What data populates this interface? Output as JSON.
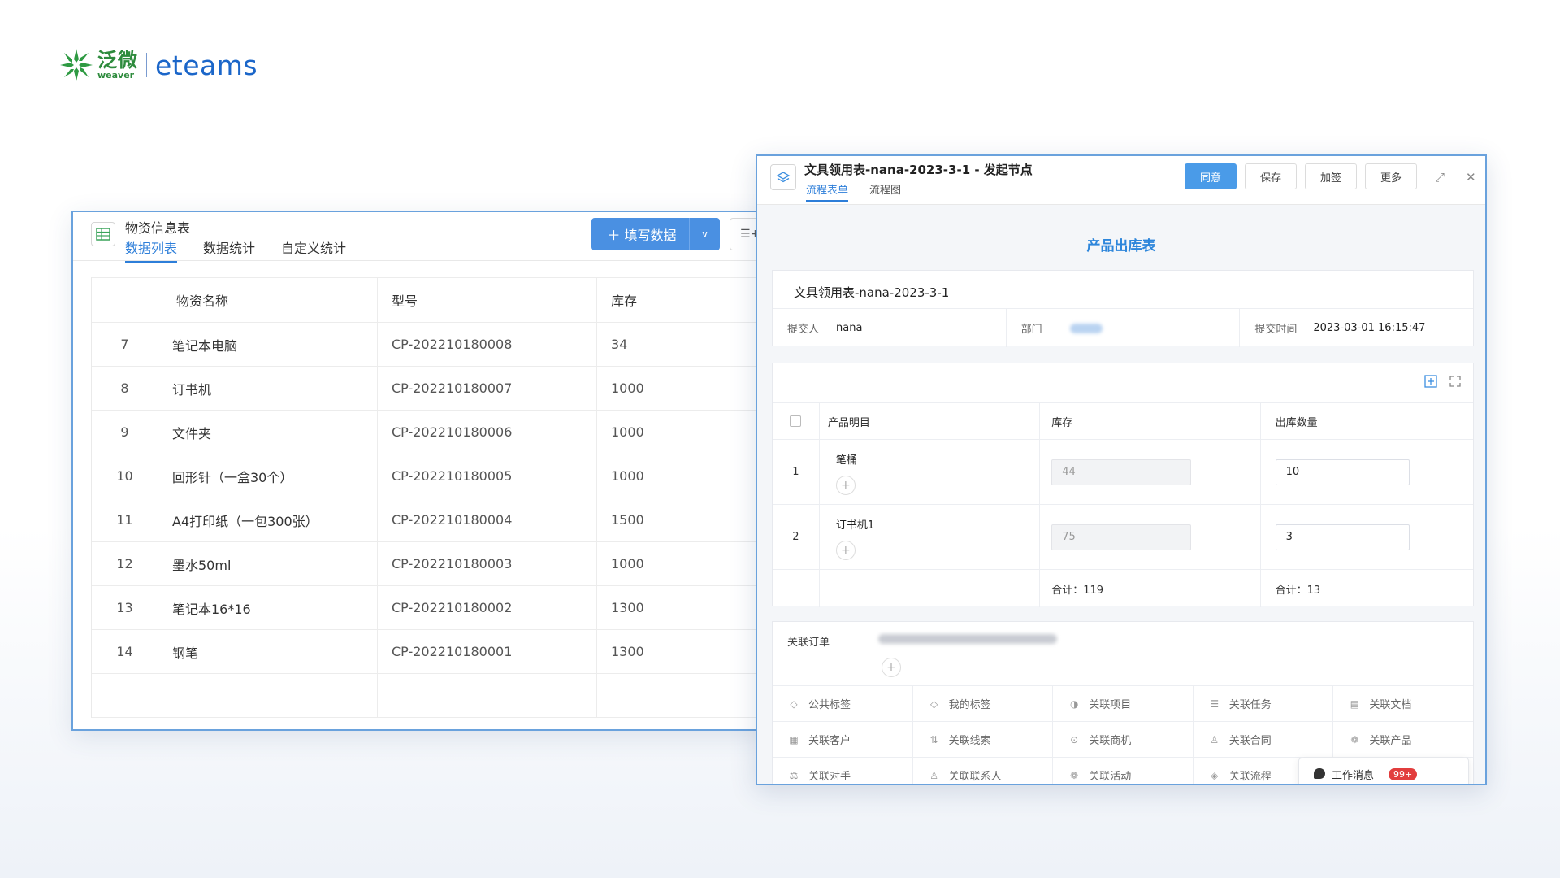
{
  "logo": {
    "zh": "泛微",
    "en": "weaver",
    "brand": "eteams"
  },
  "list_window": {
    "title": "物资信息表",
    "tabs": [
      "数据列表",
      "数据统计",
      "自定义统计"
    ],
    "fill_button": "＋ 填写数据",
    "columns": [
      "",
      "物资名称",
      "型号",
      "库存"
    ],
    "rows": [
      {
        "no": "7",
        "name": "笔记本电脑",
        "model": "CP-202210180008",
        "stock": "34"
      },
      {
        "no": "8",
        "name": "订书机",
        "model": "CP-202210180007",
        "stock": "1000"
      },
      {
        "no": "9",
        "name": "文件夹",
        "model": "CP-202210180006",
        "stock": "1000"
      },
      {
        "no": "10",
        "name": "回形针（一盒30个）",
        "model": "CP-202210180005",
        "stock": "1000"
      },
      {
        "no": "11",
        "name": "A4打印纸（一包300张）",
        "model": "CP-202210180004",
        "stock": "1500"
      },
      {
        "no": "12",
        "name": "墨水50ml",
        "model": "CP-202210180003",
        "stock": "1000"
      },
      {
        "no": "13",
        "name": "笔记本16*16",
        "model": "CP-202210180002",
        "stock": "1300"
      },
      {
        "no": "14",
        "name": "钢笔",
        "model": "CP-202210180001",
        "stock": "1300"
      }
    ]
  },
  "form_window": {
    "title": "文具领用表-nana-2023-3-1 - 发起节点",
    "tabs": [
      "流程表单",
      "流程图"
    ],
    "actions": [
      "同意",
      "保存",
      "加签",
      "更多"
    ],
    "form_title": "产品出库表",
    "record_name": "文具领用表-nana-2023-3-1",
    "submitter_label": "提交人",
    "submitter": "nana",
    "dept_label": "部门",
    "time_label": "提交时间",
    "time": "2023-03-01 16:15:47",
    "table_headers": [
      "产品明目",
      "库存",
      "出库数量"
    ],
    "rows": [
      {
        "no": "1",
        "product": "笔桶",
        "stock": "44",
        "qty": "10"
      },
      {
        "no": "2",
        "product": "订书机1",
        "stock": "75",
        "qty": "3"
      }
    ],
    "sum_stock": "合计：119",
    "sum_qty": "合计：13",
    "related_order_label": "关联订单",
    "related_items": [
      [
        "公共标签",
        "我的标签",
        "关联项目",
        "关联任务",
        "关联文档"
      ],
      [
        "关联客户",
        "关联线索",
        "关联商机",
        "关联合同",
        "关联产品"
      ],
      [
        "关联对手",
        "关联联系人",
        "关联活动",
        "关联流程",
        ""
      ]
    ],
    "related_icons": [
      [
        "tag-icon",
        "tag-icon",
        "project-icon",
        "task-list-icon",
        "document-icon"
      ],
      [
        "customer-icon",
        "clue-icon",
        "opportunity-icon",
        "contract-icon",
        "product-icon"
      ],
      [
        "competitor-icon",
        "contact-icon",
        "activity-icon",
        "workflow-icon",
        ""
      ]
    ],
    "message": {
      "label": "工作消息",
      "badge": "99+"
    }
  },
  "colors": {
    "accent": "#2d7ed9",
    "primary_button": "#4a90e2",
    "border_highlight": "#6aa2dd",
    "brand_green": "#2e8b3d",
    "badge_red": "#e23d3d"
  }
}
